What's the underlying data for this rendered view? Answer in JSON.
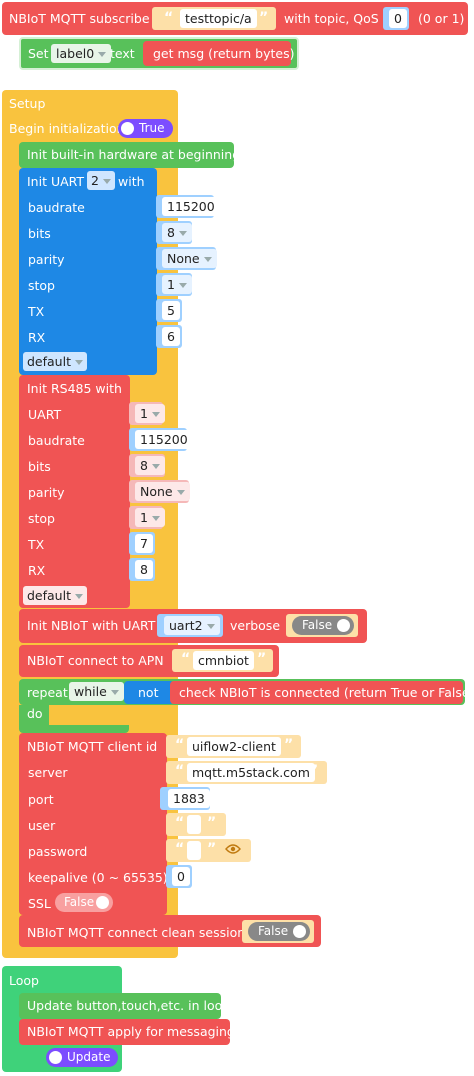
{
  "subscribe": {
    "prefix": "NBIoT MQTT subscribe",
    "topic": "testtopic/a",
    "middle": "with topic, QoS",
    "qos": "0",
    "suffix": "(0 or 1)",
    "set_label": "Set",
    "label_var": "label0",
    "text_label": "text",
    "get_msg": "get msg (return bytes)"
  },
  "setup": {
    "title": "Setup",
    "begin_label": "Begin initialization",
    "begin_value": "True",
    "init_hw": "Init built-in hardware at beginning",
    "uart": {
      "title_prefix": "Init UART",
      "uart_num": "2",
      "title_suffix": "with",
      "rows": [
        {
          "label": "baudrate",
          "value": "115200"
        },
        {
          "label": "bits",
          "value": "8"
        },
        {
          "label": "parity",
          "value": "None"
        },
        {
          "label": "stop",
          "value": "1"
        },
        {
          "label": "TX",
          "value": "5"
        },
        {
          "label": "RX",
          "value": "6"
        }
      ],
      "mode": "default"
    },
    "rs485": {
      "title": "Init RS485 with",
      "rows": [
        {
          "label": "UART",
          "value": "1"
        },
        {
          "label": "baudrate",
          "value": "115200"
        },
        {
          "label": "bits",
          "value": "8"
        },
        {
          "label": "parity",
          "value": "None"
        },
        {
          "label": "stop",
          "value": "1"
        },
        {
          "label": "TX",
          "value": "7"
        },
        {
          "label": "RX",
          "value": "8"
        }
      ],
      "mode": "default"
    },
    "nbiot_init": {
      "prefix": "Init NBIoT with UART",
      "uart": "uart2",
      "verbose": "verbose",
      "verbose_value": "False"
    },
    "apn": {
      "label": "NBIoT connect to APN",
      "value": "cmnbiot"
    },
    "repeat": {
      "label": "repeat",
      "mode": "while",
      "not": "not",
      "check": "check NBIoT is connected (return True or False)",
      "do": "do"
    },
    "client": {
      "title": "NBIoT MQTT client id",
      "client_id": "uiflow2-client",
      "server_label": "server",
      "server": "mqtt.m5stack.com",
      "port_label": "port",
      "port": "1883",
      "user_label": "user",
      "user": "",
      "password_label": "password",
      "password": "",
      "keepalive_label": "keepalive (0 ~ 65535)",
      "keepalive": "0",
      "ssl_label": "SSL",
      "ssl_value": "False"
    },
    "clean_session": {
      "label": "NBIoT MQTT connect clean session",
      "value": "False"
    }
  },
  "loop": {
    "title": "Loop",
    "update_btn": "Update button,touch,etc. in loop",
    "apply": "NBIoT MQTT apply for messaging",
    "update": "Update"
  },
  "colors": {
    "red": "#f05454",
    "green": "#58c15a",
    "yellow": "#f9c33e",
    "blue": "#1e88e5",
    "purple": "#7c4dff",
    "loop_green": "#3fd27a"
  }
}
